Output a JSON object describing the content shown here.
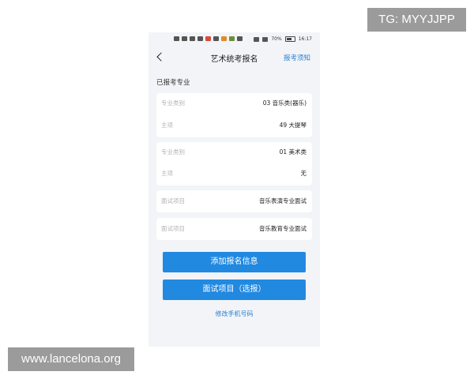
{
  "watermarks": {
    "top_right": "TG: MYYJJPP",
    "bottom_left": "www.lancelona.org"
  },
  "status_bar": {
    "battery": "70%",
    "time": "16:17"
  },
  "nav": {
    "title": "艺术统考报名",
    "right_link": "报考须知"
  },
  "section_label": "已报考专业",
  "cards": [
    {
      "rows": [
        {
          "key": "专业类别",
          "value": "03 音乐类(器乐)"
        },
        {
          "key": "主项",
          "value": "49 大提琴"
        }
      ]
    },
    {
      "rows": [
        {
          "key": "专业类别",
          "value": "01 美术类"
        },
        {
          "key": "主项",
          "value": "无"
        }
      ]
    },
    {
      "rows": [
        {
          "key": "面试项目",
          "value": "音乐表演专业面试"
        }
      ]
    },
    {
      "rows": [
        {
          "key": "面试项目",
          "value": "音乐教育专业面试"
        }
      ]
    }
  ],
  "buttons": {
    "add_info": "添加报名信息",
    "interview_optional": "面试项目（选报）"
  },
  "bottom_link": "修改手机号码",
  "colors": {
    "accent": "#2289e0",
    "link": "#2a7fd4",
    "background": "#f2f4f7"
  }
}
